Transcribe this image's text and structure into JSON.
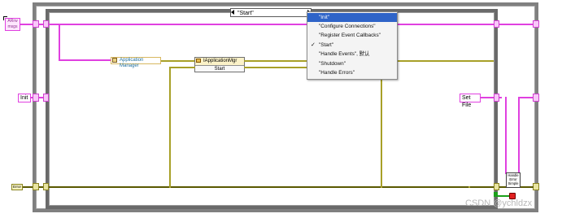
{
  "case_selector": {
    "value": "\"Start\""
  },
  "case_menu": {
    "items": [
      {
        "label": "\"Init\"",
        "active": true,
        "checked": false
      },
      {
        "label": "\"Configure Connections\"",
        "active": false,
        "checked": false
      },
      {
        "label": "\"Register Event Callbacks\"",
        "active": false,
        "checked": false
      },
      {
        "label": "\"Start\"",
        "active": false,
        "checked": true
      },
      {
        "label": "\"Handle Events\", 默认",
        "active": false,
        "checked": false
      },
      {
        "label": "\"Shutdown\"",
        "active": false,
        "checked": false
      },
      {
        "label": "\"Handle Errors\"",
        "active": false,
        "checked": false
      }
    ],
    "check_glyph": "✓"
  },
  "nodes": {
    "array_terminal": "ARrw msgs",
    "init_label": "Init",
    "app_manager_label": "Application Manager",
    "iapp_mgr_label": "IApplicationMgr",
    "start_method_label": "Start",
    "set_file_label": "Set File",
    "handle_error_label": "Handle Error Simple",
    "error_terminal_label": "Error"
  },
  "watermark": "CSDN @ychldzx",
  "colors": {
    "pink_wire": "#e040e0",
    "olive_wire": "#a8a028",
    "selected_menu": "#2f64c8"
  }
}
